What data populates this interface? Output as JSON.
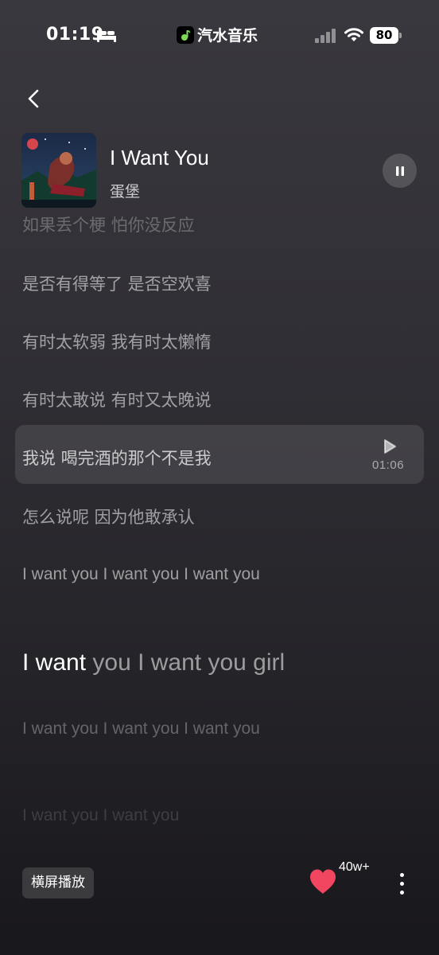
{
  "status_bar": {
    "time": "01:19",
    "app_name": "汽水音乐",
    "battery": "80"
  },
  "song": {
    "title": "I Want You",
    "artist": "蛋堡"
  },
  "lyrics": {
    "faded_top": "如果丢个梗 怕你没反应",
    "line1": "是否有得等了 是否空欢喜",
    "line2": "有时太软弱 我有时太懒惰",
    "line3": "有时太敢说 有时又太晚说",
    "current": "我说 喝完酒的那个不是我",
    "current_time": "01:06",
    "line5": "怎么说呢 因为他敢承认",
    "line6": "I want you I want you I want you",
    "active_sung": "I want",
    "active_unsung": " you I want you girl",
    "line8": "I want you I want you I want you",
    "line9": "I want you I want you"
  },
  "bottom_bar": {
    "landscape_label": "横屏播放",
    "like_count": "40w+"
  },
  "colors": {
    "heart": "#f24660",
    "background_top": "#39383e",
    "background_bottom": "#18171b"
  }
}
